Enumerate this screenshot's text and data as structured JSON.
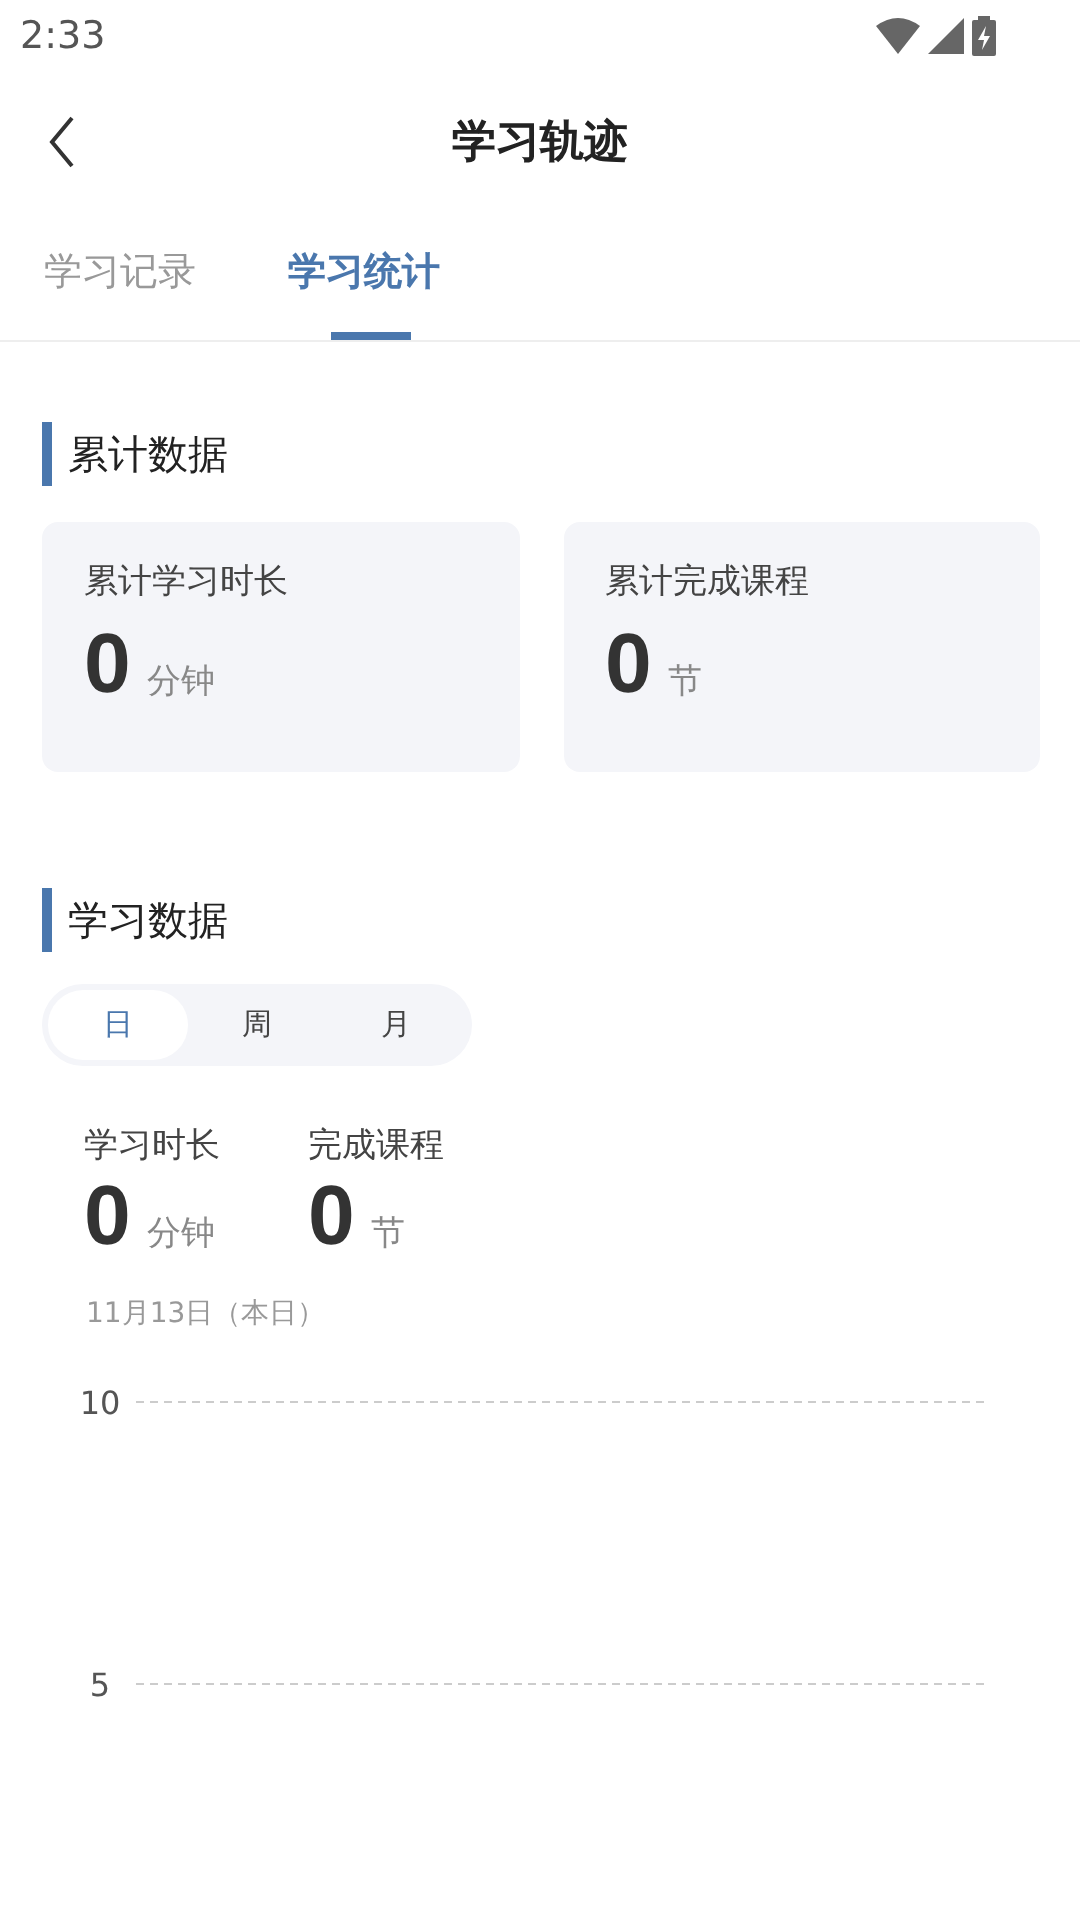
{
  "status_bar": {
    "time": "2:33"
  },
  "header": {
    "title": "学习轨迹"
  },
  "tabs": [
    {
      "label": "学习记录",
      "selected": false
    },
    {
      "label": "学习统计",
      "selected": true
    }
  ],
  "totals": {
    "title": "累计数据",
    "cards": [
      {
        "label": "累计学习时长",
        "value": "0",
        "unit": "分钟"
      },
      {
        "label": "累计完成课程",
        "value": "0",
        "unit": "节"
      }
    ]
  },
  "study": {
    "title": "学习数据",
    "periods": [
      {
        "label": "日",
        "selected": true
      },
      {
        "label": "周",
        "selected": false
      },
      {
        "label": "月",
        "selected": false
      }
    ],
    "stats": [
      {
        "label": "学习时长",
        "value": "0",
        "unit": "分钟"
      },
      {
        "label": "完成课程",
        "value": "0",
        "unit": "节"
      }
    ],
    "date": "11月13日（本日）",
    "chart_axis_labels": [
      "10",
      "5"
    ]
  }
}
